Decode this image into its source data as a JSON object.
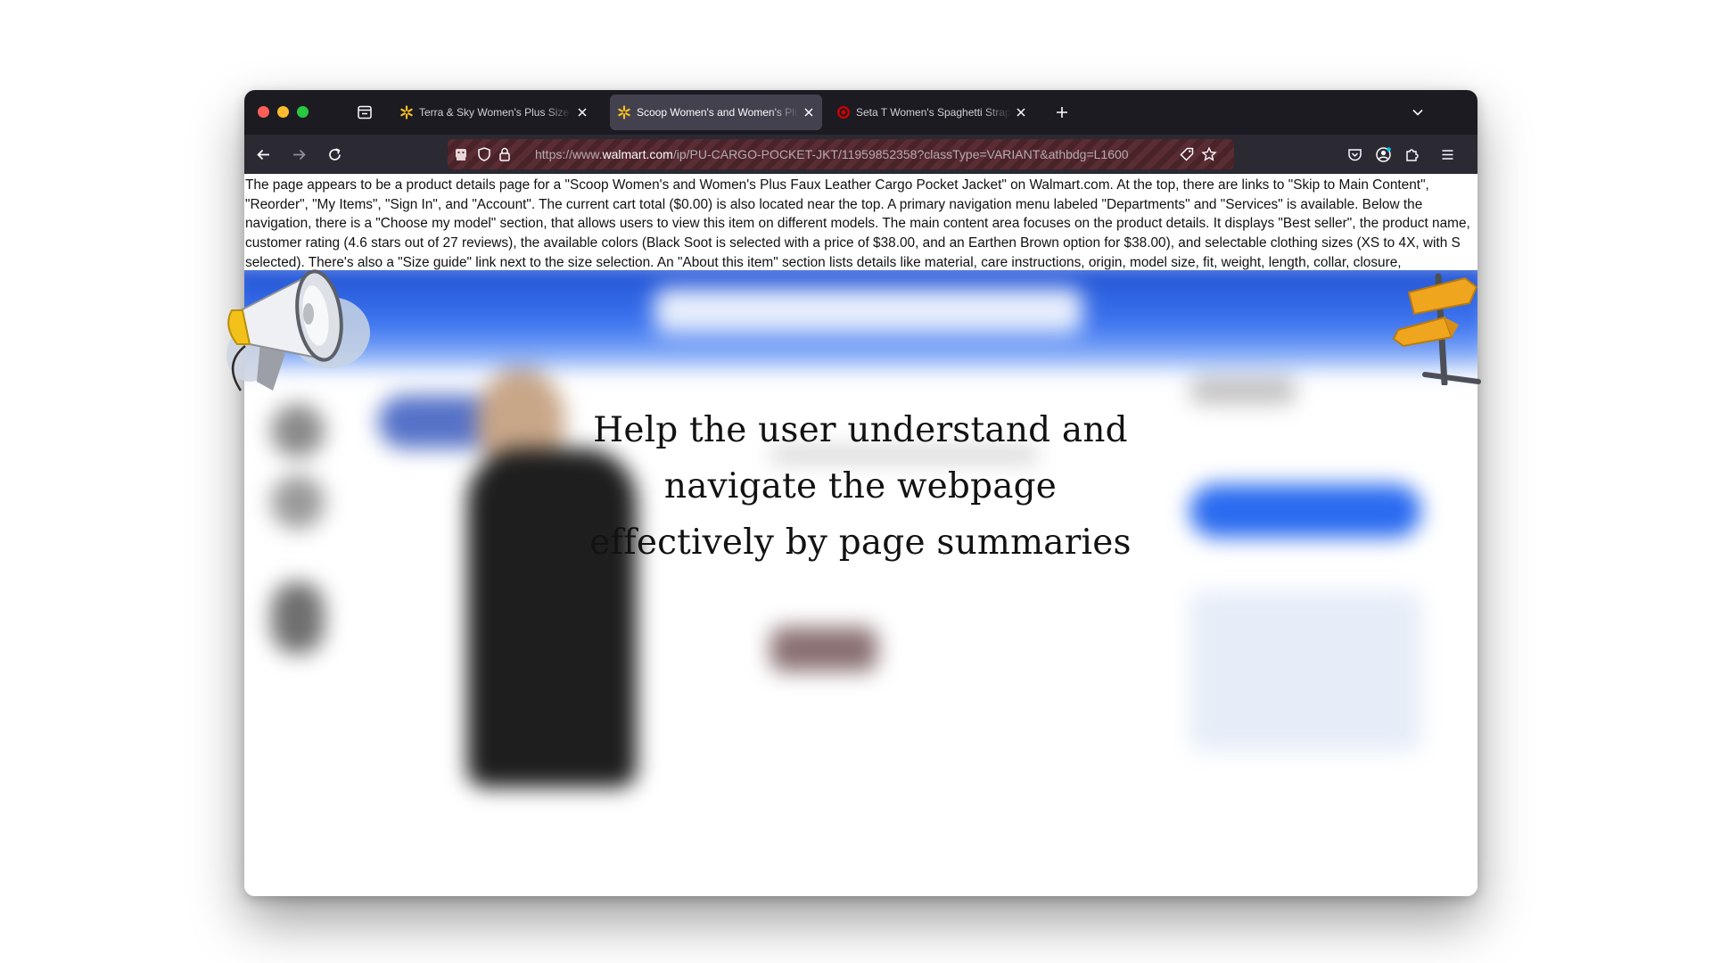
{
  "browser": {
    "tabs": [
      {
        "title": "Terra & Sky Women's Plus Size Denim",
        "favicon": "walmart-spark-icon",
        "active": false
      },
      {
        "title": "Scoop Women's and Women's Plus Faux",
        "favicon": "walmart-spark-icon",
        "active": true
      },
      {
        "title": "Seta T Women's Spaghetti Strap",
        "favicon": "target-bullseye-icon",
        "active": false
      }
    ],
    "url_prefix": "https://www.",
    "url_domain": "walmart.com",
    "url_path": "/ip/PU-CARGO-POCKET-JKT/11959852358?classType=VARIANT&athbdg=L1600"
  },
  "page": {
    "summary": "The page appears to be a product details page for a \"Scoop Women's and Women's Plus Faux Leather Cargo Pocket Jacket\" on Walmart.com. At the top, there are links to \"Skip to Main Content\", \"Reorder\", \"My Items\", \"Sign In\", and \"Account\". The current cart total ($0.00) is also located near the top. A primary navigation menu labeled \"Departments\" and \"Services\" is available. Below the navigation, there is a \"Choose my model\" section, that allows users to view this item on different models. The main content area focuses on the product details. It displays \"Best seller\", the product name, customer rating (4.6 stars out of 27 reviews), the available colors (Black Soot is selected with a price of $38.00, and an Earthen Brown option for $38.00), and selectable clothing sizes (XS to 4X, with S selected). There's also a \"Size guide\" link next to the size selection. An \"About this item\" section lists details like material, care instructions, origin, model size, fit, weight, length, collar, closure,"
  },
  "overlay": {
    "headline": "Help the user understand and navigate the webpage effectively by page summaries"
  },
  "colors": {
    "tab_strip": "#1c1b22",
    "nav_bar": "#2b2a33",
    "active_tab": "#42414d",
    "walmart_blue": "#1f4fd0",
    "walmart_yellow": "#ffc220",
    "target_red": "#cc0000"
  }
}
